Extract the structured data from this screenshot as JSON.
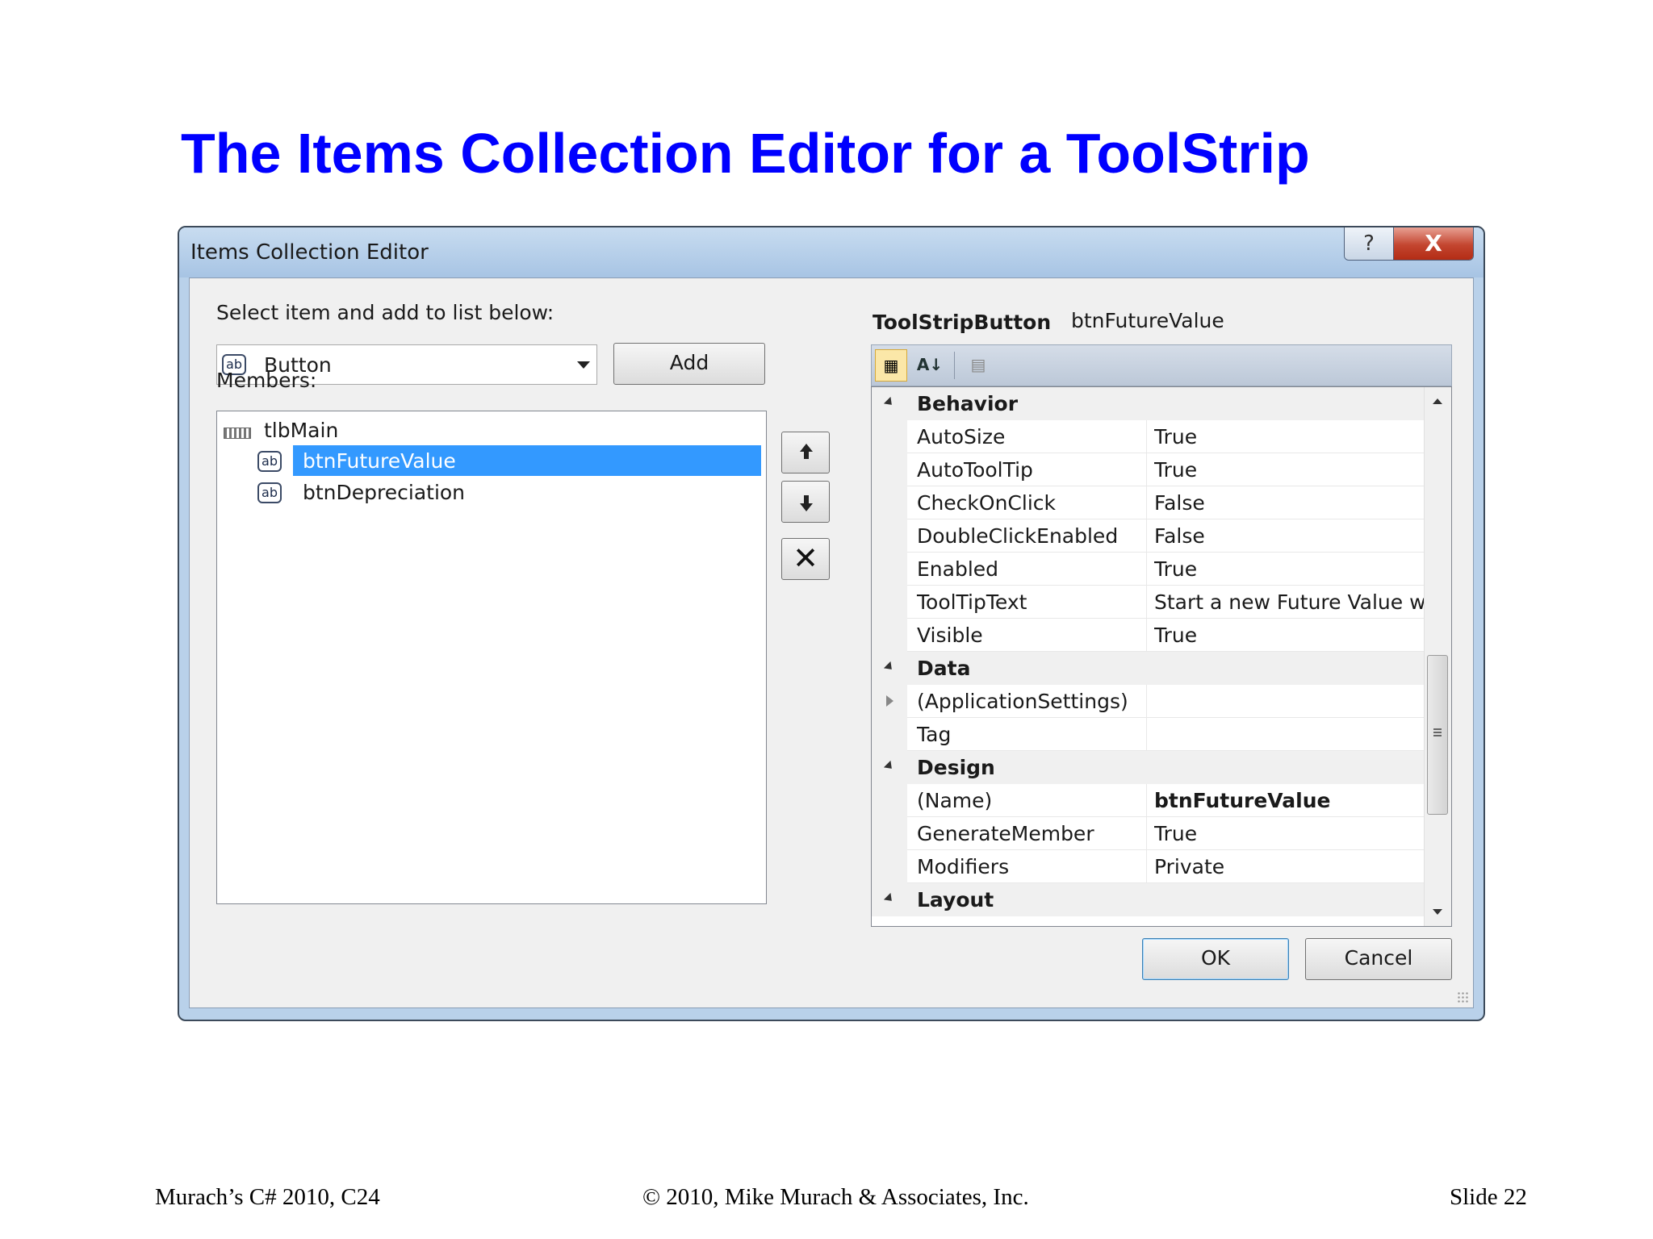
{
  "slide": {
    "title": "The Items Collection Editor for a ToolStrip",
    "footer_left": "Murach’s C# 2010, C24",
    "footer_center": "© 2010, Mike Murach & Associates, Inc.",
    "footer_right": "Slide 22"
  },
  "dialog": {
    "title": "Items Collection Editor",
    "help_glyph": "?",
    "close_glyph": "X",
    "select_label": "Select item and add to list below:",
    "item_type": {
      "icon_text": "ab",
      "value": "Button"
    },
    "add_label": "Add",
    "members_label": "Members:",
    "members": [
      {
        "name": "tlbMain",
        "icon": "toolstrip-icon",
        "level": 0,
        "selected": false
      },
      {
        "name": "btnFutureValue",
        "icon": "ab",
        "level": 1,
        "selected": true
      },
      {
        "name": "btnDepreciation",
        "icon": "ab",
        "level": 1,
        "selected": false
      }
    ],
    "move_up_icon": "arrow-up-icon",
    "move_down_icon": "arrow-down-icon",
    "remove_icon": "x-icon",
    "properties": {
      "object_type": "ToolStripButton",
      "object_name": "btnFutureValue",
      "toolbar": {
        "categorized_icon": "categorized-icon",
        "alphabetical_glyph": "A↓",
        "pages_icon": "property-pages-icon"
      },
      "rows": [
        {
          "kind": "category",
          "name": "Behavior"
        },
        {
          "kind": "property",
          "name": "AutoSize",
          "value": "True"
        },
        {
          "kind": "property",
          "name": "AutoToolTip",
          "value": "True"
        },
        {
          "kind": "property",
          "name": "CheckOnClick",
          "value": "False"
        },
        {
          "kind": "property",
          "name": "DoubleClickEnabled",
          "value": "False"
        },
        {
          "kind": "property",
          "name": "Enabled",
          "value": "True"
        },
        {
          "kind": "property",
          "name": "ToolTipText",
          "value": "Start a new Future Value wind"
        },
        {
          "kind": "property",
          "name": "Visible",
          "value": "True"
        },
        {
          "kind": "category",
          "name": "Data"
        },
        {
          "kind": "property",
          "name": "(ApplicationSettings)",
          "value": "",
          "expandable": true
        },
        {
          "kind": "property",
          "name": "Tag",
          "value": ""
        },
        {
          "kind": "category",
          "name": "Design"
        },
        {
          "kind": "property",
          "name": "(Name)",
          "value": "btnFutureValue",
          "bold": true
        },
        {
          "kind": "property",
          "name": "GenerateMember",
          "value": "True"
        },
        {
          "kind": "property",
          "name": "Modifiers",
          "value": "Private"
        },
        {
          "kind": "category",
          "name": "Layout"
        }
      ]
    },
    "ok_label": "OK",
    "cancel_label": "Cancel",
    "colors": {
      "title_blue": "#0000ff",
      "selection": "#3399ff",
      "close_red": "#c3452f",
      "frame": "#b9d1ea"
    }
  }
}
